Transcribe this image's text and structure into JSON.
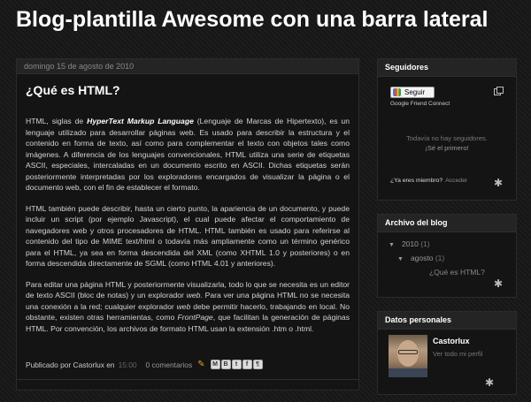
{
  "blog": {
    "title": "Blog-plantilla Awesome con una barra lateral"
  },
  "post": {
    "date": "domingo 15 de agosto de 2010",
    "title": "¿Qué es HTML?",
    "p1_a": "HTML, siglas de ",
    "p1_b": "HyperText Markup Language",
    "p1_c": " (Lenguaje de Marcas de Hipertexto), es un lenguaje utilizado para desarrollar páginas web. Es usado para describir la estructura y el contenido en forma de texto, así como para complementar el texto con objetos tales como imágenes. A diferencia de los lenguajes convencionales, HTML utiliza una serie de etiquetas ASCII, especiales, intercaladas en un documento escrito en ASCII. Dichas etiquetas serán posteriormente interpretadas por los exploradores encargados de visualizar la página o el documento web, con el fin de establecer el formato.",
    "p2": "HTML también puede describir, hasta un cierto punto, la apariencia de un documento, y puede incluir un script (por ejemplo Javascript), el cual puede afectar el comportamiento de navegadores web y otros procesadores de HTML. HTML también es usado para referirse al contenido del tipo de MIME text/html o todavía más ampliamente como un término genérico para el HTML, ya sea en forma descendida del XML (como XHTML 1.0 y posteriores) o en forma descendida directamente de SGML (como HTML 4.01 y anteriores).",
    "p3_a": "Para editar una página HTML y posteriormente visualizarla, todo lo que se necesita es un editor de texto ASCII (bloc de notas) y un explorador ",
    "p3_b": "web",
    "p3_c": ". Para ver una página HTML no se necesita una conexión a la red; cualquier explorador ",
    "p3_d": "web",
    "p3_e": " debe permitir hacerlo, trabajando en local. No obstante, existen otras herramientas, como ",
    "p3_f": "FrontPage",
    "p3_g": ", que facilitan la generación de páginas HTML. Por convención, los archivos de formato HTML usan la extensión .htm o .html.",
    "footer": {
      "published_by": "Publicado por Castorlux en",
      "time": "15:00",
      "comments": "0 comentarios",
      "share_buttons": [
        "M",
        "B",
        "t",
        "f",
        "¶"
      ]
    }
  },
  "followers": {
    "title": "Seguidores",
    "follow_button": "Seguir",
    "gfc_label": "Google Friend Connect",
    "empty_line1": "Todavía no hay seguidores.",
    "empty_line2": "¡Sé el primero!",
    "member_question": "¿Ya eres miembro?",
    "access_link": "Acceder"
  },
  "archive": {
    "title": "Archivo del blog",
    "year": "2010",
    "year_count": "(1)",
    "month": "agosto",
    "month_count": "(1)",
    "post_link": "¿Qué es HTML?"
  },
  "profile": {
    "title": "Datos personales",
    "name": "Castorlux",
    "view_profile": "Ver todo mi perfil"
  },
  "colors": {
    "background": "#1a1a1a",
    "panel": "#141414",
    "header_bar": "#242424"
  }
}
